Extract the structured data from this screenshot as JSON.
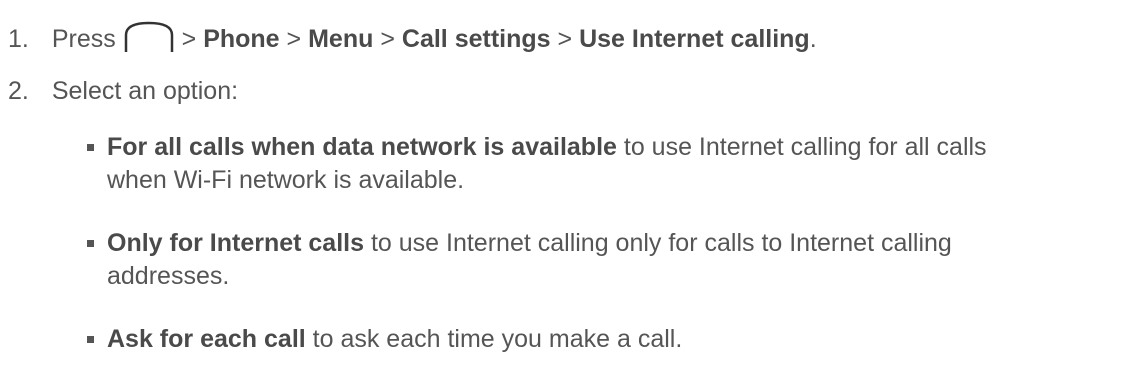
{
  "steps": [
    {
      "number": "1.",
      "parts": {
        "press": "Press",
        "sep1": ">",
        "phone": "Phone",
        "sep2": ">",
        "menu": "Menu",
        "sep3": ">",
        "call_settings": "Call settings",
        "sep4": ">",
        "use_internet_calling": "Use Internet calling",
        "end": "."
      },
      "icon": "home-icon"
    },
    {
      "number": "2.",
      "text": "Select an option:"
    }
  ],
  "options": [
    {
      "bold": "For all calls when data network is available",
      "rest_line1": " to use Internet calling for all calls",
      "line2": "when Wi-Fi network is available."
    },
    {
      "bold": "Only for Internet calls",
      "rest_line1": " to use Internet calling only for calls to Internet calling",
      "line2": "addresses."
    },
    {
      "bold": "Ask for each call",
      "rest_line1": " to ask each time you make a call."
    }
  ]
}
